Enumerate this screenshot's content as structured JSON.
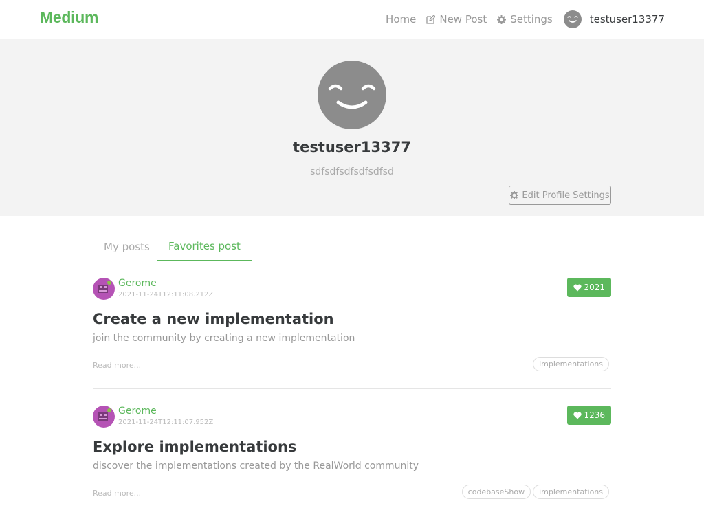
{
  "navbar": {
    "brand": "Medium",
    "links": [
      {
        "label": "Home",
        "icon": "none"
      },
      {
        "label": "New Post",
        "icon": "compose-icon"
      },
      {
        "label": "Settings",
        "icon": "gear-icon"
      }
    ],
    "username": "testuser13377"
  },
  "profile": {
    "username": "testuser13377",
    "bio": "sdfsdfsdfsdfsdfsd",
    "edit_button": "Edit Profile Settings"
  },
  "tabs": [
    {
      "label": "My posts",
      "active": false
    },
    {
      "label": "Favorites post",
      "active": true
    }
  ],
  "articles": [
    {
      "author": "Gerome",
      "date": "2021-11-24T12:11:08.212Z",
      "favorites": "2021",
      "title": "Create a new implementation",
      "description": "join the community by creating a new implementation",
      "read_more": "Read more...",
      "tags": [
        "implementations"
      ]
    },
    {
      "author": "Gerome",
      "date": "2021-11-24T12:11:07.952Z",
      "favorites": "1236",
      "title": "Explore implementations",
      "description": "discover the implementations created by the RealWorld community",
      "read_more": "Read more...",
      "tags": [
        "codebaseShow",
        "implementations"
      ]
    }
  ],
  "colors": {
    "accent": "#5cb85c",
    "banner": "#f3f3f3",
    "avatar_gray": "#8c8c8c"
  }
}
